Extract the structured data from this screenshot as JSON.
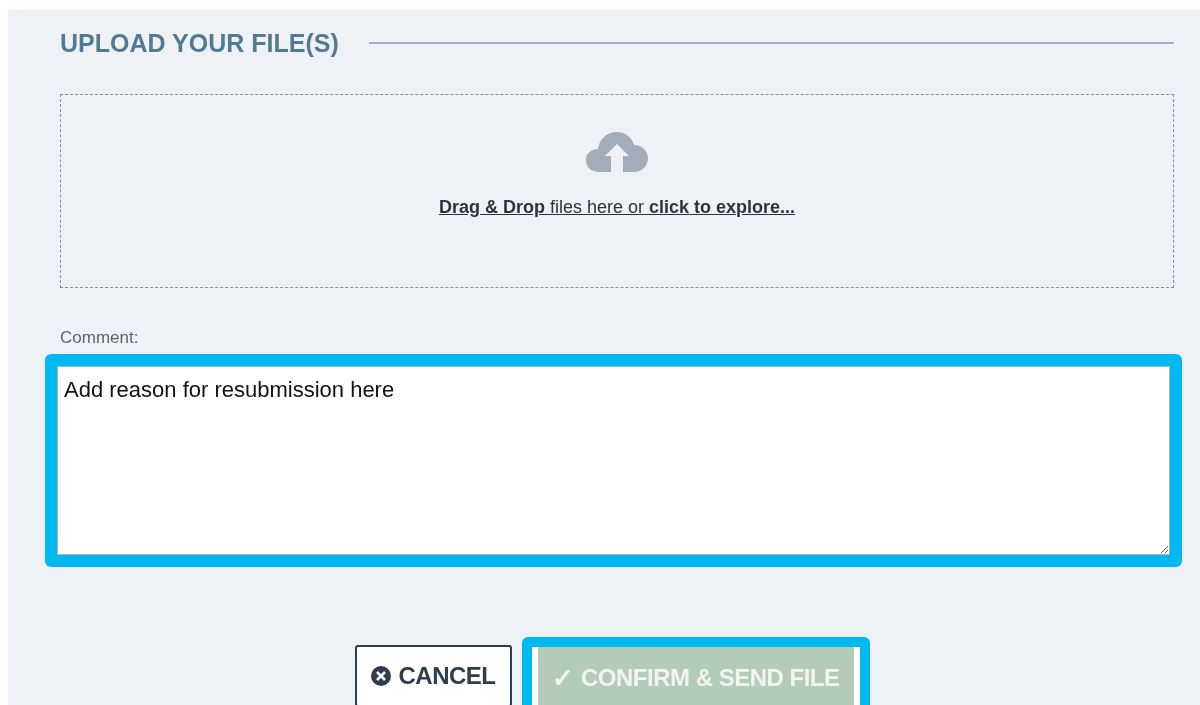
{
  "section": {
    "title": "UPLOAD YOUR FILE(S)"
  },
  "dropzone": {
    "instruction": "**Drag & Drop** files here or **click to explore...**"
  },
  "comment": {
    "label": "Comment:",
    "value": "Add reason for resubmission here",
    "highlighted": true
  },
  "buttons": [
    {
      "kind": "cancel",
      "label": "CANCEL",
      "disabled": false,
      "highlighted": false
    },
    {
      "kind": "confirm",
      "icon": "✓",
      "label": "CONFIRM & SEND FILE",
      "disabled": true,
      "highlighted": true
    }
  ]
}
